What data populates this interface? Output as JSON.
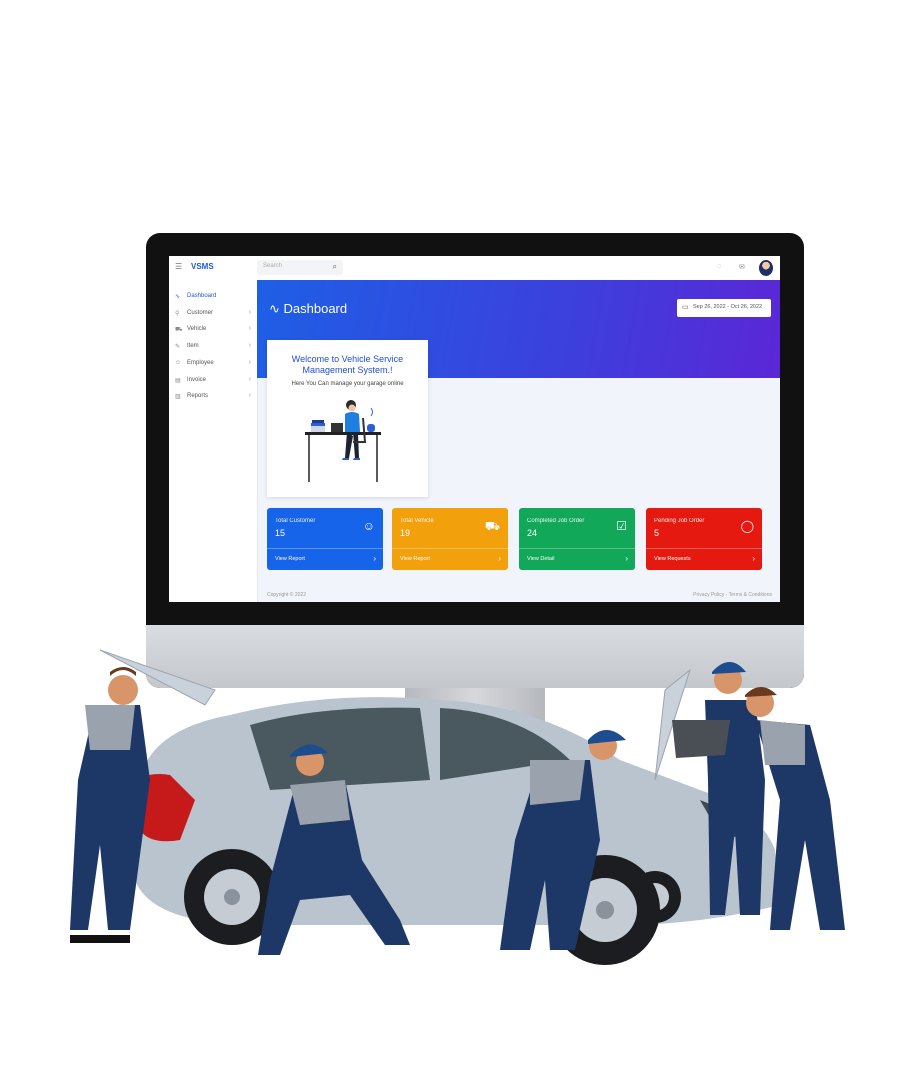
{
  "app": {
    "logo_text": "VSMS"
  },
  "search": {
    "placeholder": "Search"
  },
  "sidebar": {
    "items": [
      {
        "label": "Dashboard",
        "icon": "dashboard-icon",
        "glyph": "∿"
      },
      {
        "label": "Customer",
        "icon": "user-icon",
        "glyph": "⚲"
      },
      {
        "label": "Vehicle",
        "icon": "car-icon",
        "glyph": "⛟"
      },
      {
        "label": "Item",
        "icon": "wrench-icon",
        "glyph": "✎"
      },
      {
        "label": "Employee",
        "icon": "employee-icon",
        "glyph": "☺"
      },
      {
        "label": "Invoice",
        "icon": "invoice-icon",
        "glyph": "▤"
      },
      {
        "label": "Reports",
        "icon": "reports-icon",
        "glyph": "▥"
      }
    ]
  },
  "main": {
    "title": "Dashboard",
    "date_range": "Sep 26, 2022 - Oct 26, 2022"
  },
  "welcome": {
    "title": "Welcome to Vehicle Service Management System.!",
    "subtitle": "Here You Can manage your garage online"
  },
  "cards": [
    {
      "label": "Total Customer",
      "value": "15",
      "link": "View Report",
      "color": "#1664ea",
      "icon": "user-icon",
      "glyph": "☺"
    },
    {
      "label": "Total Vehicle",
      "value": "19",
      "link": "View Report",
      "color": "#f2a10c",
      "icon": "truck-icon",
      "glyph": "⛟"
    },
    {
      "label": "Completed Job Order",
      "value": "24",
      "link": "View Detail",
      "color": "#12a85a",
      "icon": "checkbox-icon",
      "glyph": "☑"
    },
    {
      "label": "Pending Job Order",
      "value": "5",
      "link": "View Requests",
      "color": "#e5190f",
      "icon": "chat-icon",
      "glyph": "◯"
    }
  ],
  "footer": {
    "copyright": "Copyright © 2022",
    "links": "Privacy Policy · Terms & Conditions"
  },
  "colors": {
    "accent": "#2456d6",
    "hero_start": "#1e5fe6",
    "hero_end": "#5b27d6"
  }
}
